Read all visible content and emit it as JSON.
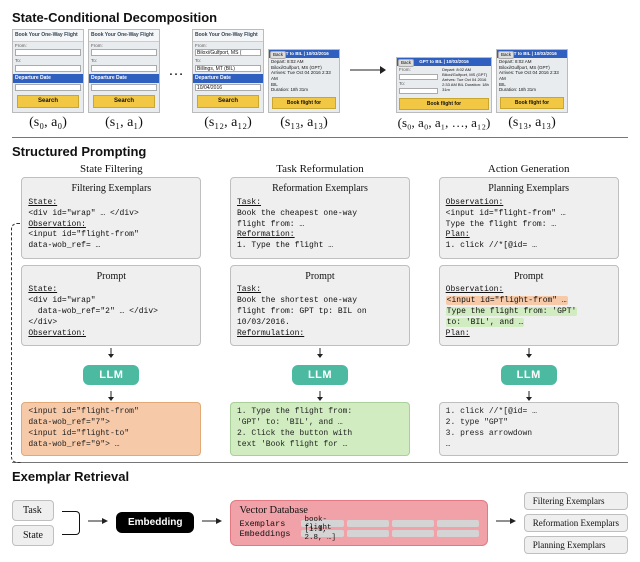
{
  "section1": {
    "title": "State-Conditional Decomposition",
    "cards": {
      "formTitle": "Book Your One-Way Flight",
      "fromLabel": "From:",
      "toLabel": "To:",
      "depHeader": "Departure Date",
      "search": "Search",
      "back": "Back",
      "fromFilled": "Biloxi/Gulfport, MS (",
      "toFilled": "Billings, MT (BIL)",
      "dateFilled": "10/04/2016",
      "routeHeader": "GPT to BIL | 10/03/2016",
      "travel": "Depart: 8:02 AM\nBiloxi/Gulfport, MS (GPT)\nArrives: Tue Oct 04 2016 2:33 AM\nBIL\nDuration: 18h 31m",
      "bookBtn": "Book flight for"
    },
    "labels": [
      "(s₀, a₀)",
      "(s₁, a₁)",
      "(s₁₂, a₁₂)",
      "(s₁₃, a₁₃)",
      "(s₀, a₀, a₁, …, a₁₂)",
      "(s₁₃, a₁₃)"
    ]
  },
  "section2": {
    "title": "Structured Prompting",
    "cols": [
      {
        "name": "State Filtering",
        "exTitle": "Filtering Exemplars",
        "exemplar": "State:\n<div id=\"wrap\" … </div>\nObservation:\n<input id=\"flight-from\"\ndata-wob_ref= …",
        "promptTitle": "Prompt",
        "promptLines": [
          {
            "t": "State:",
            "u": true
          },
          {
            "t": "<div id=\"wrap\""
          },
          {
            "t": "  data-wob_ref=\"2\" … </div>"
          },
          {
            "t": "</div>"
          },
          {
            "t": "Observation:",
            "u": true
          }
        ],
        "result": "<input id=\"flight-from\"\ndata-wob_ref=\"7\">\n<input id=\"flight-to\"\ndata-wob_ref=\"9\"> …",
        "resultClass": "bg-orange"
      },
      {
        "name": "Task Reformulation",
        "exTitle": "Reformation Exemplars",
        "exemplar": "Task:\nBook the cheapest one-way\nflight from: …\nReformation:\n1. Type the flight …",
        "promptTitle": "Prompt",
        "promptLines": [
          {
            "t": "Task:",
            "u": true
          },
          {
            "t": "Book the shortest one-way"
          },
          {
            "t": "flight from: GPT tp: BIL on"
          },
          {
            "t": "10/03/2016."
          },
          {
            "t": "Reformulation:",
            "u": true
          }
        ],
        "result": "1. Type the flight from:\n'GPT' to: 'BIL', and …\n2. Click the button with\ntext 'Book flight for …",
        "resultClass": "bg-green"
      },
      {
        "name": "Action Generation",
        "exTitle": "Planning Exemplars",
        "exemplar": "Observation:\n<input id=\"flight-from\" …\nType the flight from: …\nPlan:\n1. click //*[@id= …",
        "promptTitle": "Prompt",
        "promptLines": [
          {
            "t": "Observation:",
            "u": true
          },
          {
            "t": "<input id=\"flight-from\" …",
            "hl": "orange"
          },
          {
            "t": "Type the flight from: 'GPT'",
            "hl": "green"
          },
          {
            "t": "to: 'BIL', and …",
            "hl": "green"
          },
          {
            "t": "Plan:",
            "u": true
          }
        ],
        "result": "1. click //*[@id= …\n2. type \"GPT\"\n3. press arrowdown\n…",
        "resultClass": "bg-gray"
      }
    ],
    "llm": "LLM"
  },
  "section3": {
    "title": "Exemplar Retrieval",
    "task": "Task",
    "state": "State",
    "embedding": "Embedding",
    "vdb": {
      "title": "Vector Database",
      "row1": "Exemplars",
      "row1stub": "book-flight",
      "row2": "Embeddings",
      "row2stub": "[1.1, 2.8, …]"
    },
    "out": [
      "Filtering Exemplars",
      "Reformation Exemplars",
      "Planning Exemplars"
    ]
  }
}
